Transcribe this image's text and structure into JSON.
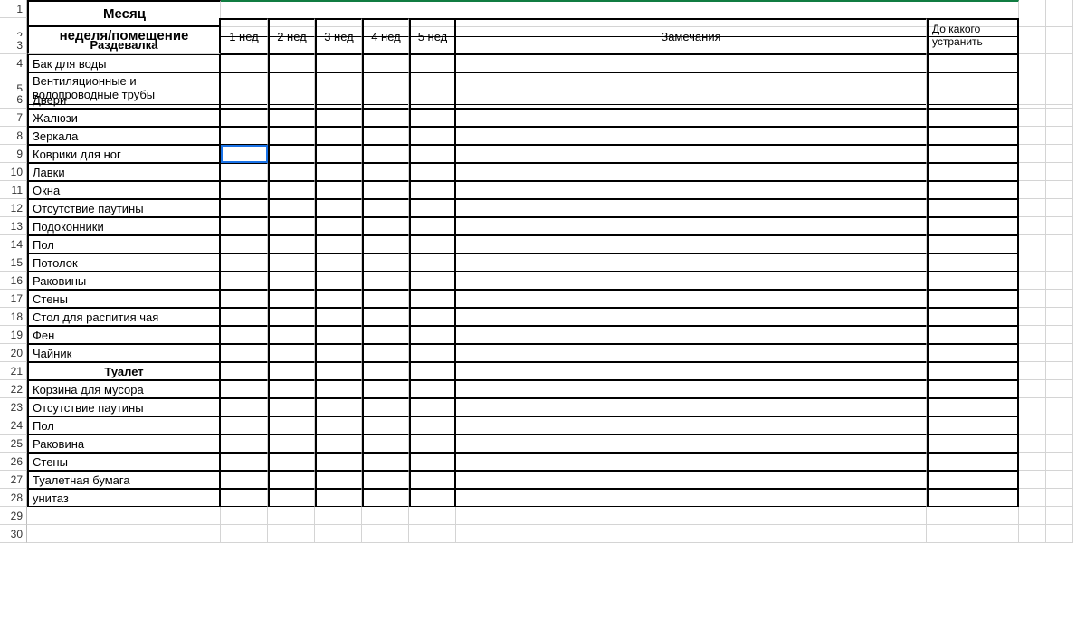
{
  "row_numbers": [
    "1",
    "2",
    "3",
    "4",
    "5",
    "6",
    "7",
    "8",
    "9",
    "10",
    "11",
    "12",
    "13",
    "14",
    "15",
    "16",
    "17",
    "18",
    "19",
    "20",
    "21",
    "22",
    "23",
    "24",
    "25",
    "26",
    "27",
    "28",
    "29",
    "30"
  ],
  "header": {
    "month": "Месяц",
    "week_room": "неделя/помещение",
    "weeks": [
      "1 нед",
      "2 нед",
      "3 нед",
      "4 нед",
      "5 нед"
    ],
    "notes": "Замечания",
    "deadline": "До какого устранить"
  },
  "sections": {
    "s1": "Раздевалка",
    "s2": "Туалет"
  },
  "items_s1": [
    "Бак для воды",
    "Вентиляционные и водопроводные трубы",
    "Двери",
    "Жалюзи",
    "Зеркала",
    "Коврики для ног",
    "Лавки",
    "Окна",
    "Отсутствие паутины",
    "Подоконники",
    "Пол",
    "Потолок",
    "Раковины",
    "Стены",
    "Стол для распития чая",
    "Фен",
    "Чайник"
  ],
  "items_s2": [
    "Корзина для мусора",
    "Отсутствие паутины",
    "Пол",
    "Раковина",
    "Стены",
    "Туалетная бумага",
    "унитаз"
  ]
}
